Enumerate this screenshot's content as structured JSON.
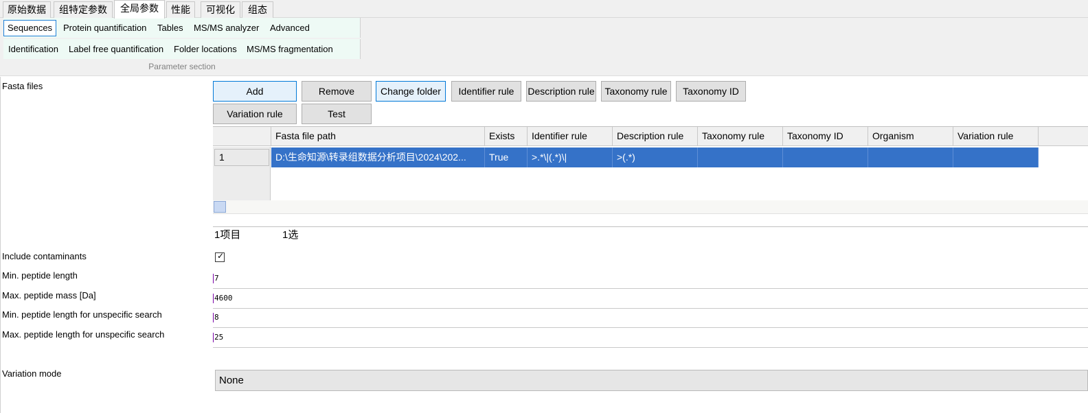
{
  "top_tabs": [
    "原始数据",
    "组特定参数",
    "全局参数",
    "性能",
    "可视化",
    "组态"
  ],
  "active_top_tab": "全局参数",
  "parameter_section": {
    "row1": [
      "Sequences",
      "Protein quantification",
      "Tables",
      "MS/MS analyzer",
      "Advanced"
    ],
    "row2": [
      "Identification",
      "Label free quantification",
      "Folder locations",
      "MS/MS fragmentation"
    ],
    "selected": "Sequences",
    "label": "Parameter section"
  },
  "fasta": {
    "label": "Fasta files",
    "buttons": [
      "Add",
      "Remove",
      "Change folder",
      "Identifier rule",
      "Description rule",
      "Taxonomy rule",
      "Taxonomy ID",
      "Variation rule",
      "Test"
    ],
    "columns": [
      "Fasta file path",
      "Exists",
      "Identifier rule",
      "Description rule",
      "Taxonomy rule",
      "Taxonomy ID",
      "Organism",
      "Variation rule"
    ],
    "rows": [
      {
        "num": "1",
        "path": "D:\\生命知源\\转录组数据分析项目\\2024\\202...",
        "exists": "True",
        "identifier_rule": ">.*\\|(.*)\\|",
        "description_rule": ">(.*)",
        "taxonomy_rule": "",
        "taxonomy_id": "",
        "organism": "",
        "variation_rule": ""
      }
    ],
    "status_items": "1项目",
    "status_selected": "1选"
  },
  "params": {
    "include_contaminants": {
      "label": "Include contaminants",
      "checked": true
    },
    "min_peptide_length": {
      "label": "Min. peptide length",
      "value": "7"
    },
    "max_peptide_mass": {
      "label": "Max. peptide mass [Da]",
      "value": "4600"
    },
    "min_len_unspecific": {
      "label": "Min. peptide length for unspecific search",
      "value": "8"
    },
    "max_len_unspecific": {
      "label": "Max. peptide length for unspecific search",
      "value": "25"
    },
    "variation_mode": {
      "label": "Variation mode",
      "value": "None"
    }
  },
  "colors": {
    "selection": "#3572c8",
    "focus_border": "#1e7fd6",
    "ribbon_bg": "#eefaf5"
  }
}
